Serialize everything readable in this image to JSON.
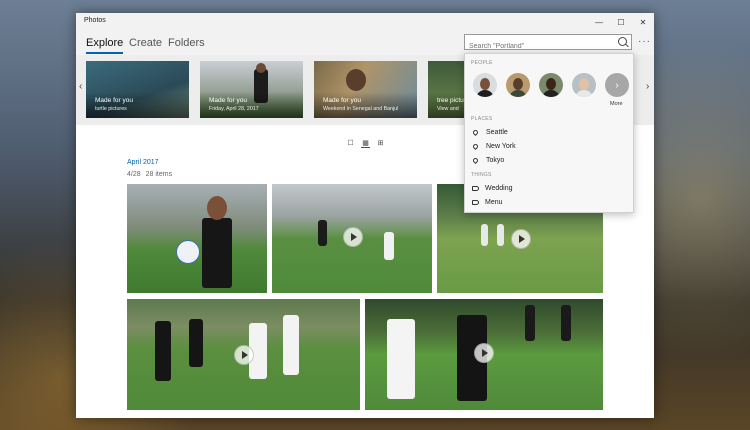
{
  "window": {
    "title": "Photos",
    "minimize": "—",
    "maximize": "☐",
    "close": "✕"
  },
  "nav": {
    "tabs": [
      {
        "label": "Explore",
        "active": true
      },
      {
        "label": "Create",
        "active": false
      },
      {
        "label": "Folders",
        "active": false
      }
    ],
    "more": "···"
  },
  "search": {
    "placeholder": "Search \"Portland\"",
    "value": ""
  },
  "strip": {
    "prev": "‹",
    "next": "›",
    "cards": [
      {
        "title": "Made for you",
        "subtitle": "turtle pictures"
      },
      {
        "title": "Made for you",
        "subtitle": "Friday, April 28, 2017"
      },
      {
        "title": "Made for you",
        "subtitle": "Weekend in Senegal and Banjul"
      },
      {
        "title": "tree pictu",
        "subtitle": "View and"
      }
    ]
  },
  "view_toggles": {
    "single": "☐",
    "grid": "▦",
    "small_grid": "⊞"
  },
  "timeline": {
    "month": "April 2017",
    "date": "4/28",
    "count": "28 items"
  },
  "dropdown": {
    "people_header": "PEOPLE",
    "more_label": "More",
    "more_arrow": "›",
    "places_header": "PLACES",
    "places": [
      "Seattle",
      "New York",
      "Tokyo"
    ],
    "things_header": "THINGS",
    "things": [
      "Wedding",
      "Menu"
    ]
  },
  "colors": {
    "accent": "#0063b1",
    "field": "#4f8a3a"
  }
}
